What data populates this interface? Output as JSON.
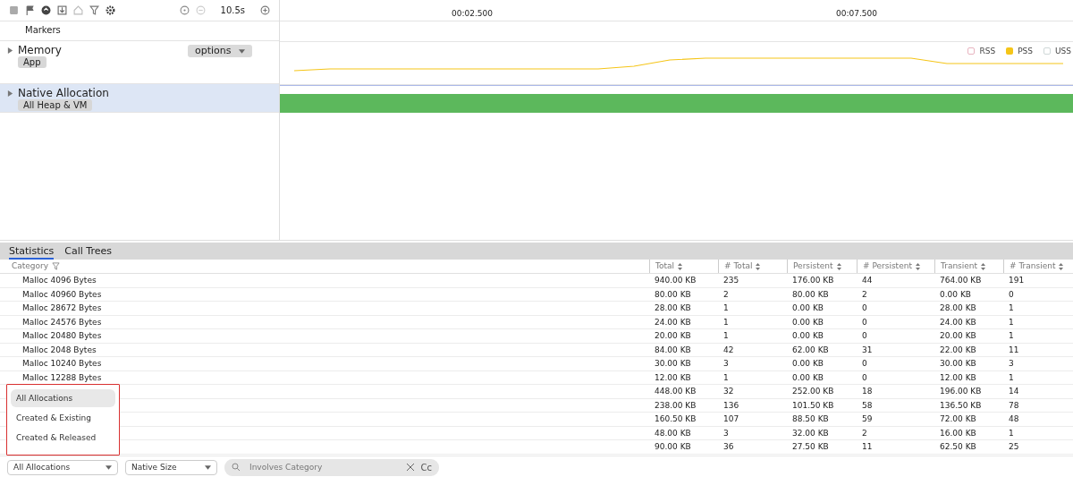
{
  "toolbar": {
    "duration": "10.5s"
  },
  "timeline": {
    "ticks": [
      "00:02.500",
      "00:07.500"
    ]
  },
  "tracks": [
    {
      "kind": "markers",
      "title": "Markers"
    },
    {
      "kind": "memory",
      "title": "Memory",
      "tag": "App",
      "options": "options",
      "expanded": false,
      "selected": false,
      "legend": [
        {
          "label": "RSS",
          "color": "#e8b4c0",
          "on": false
        },
        {
          "label": "PSS",
          "color": "#f5c518",
          "on": true
        },
        {
          "label": "USS",
          "color": "#cfd8d8",
          "on": false
        }
      ]
    },
    {
      "kind": "native",
      "title": "Native Allocation",
      "tag": "All Heap & VM",
      "expanded": false,
      "selected": true
    }
  ],
  "tabs": [
    {
      "label": "Statistics",
      "selected": true
    },
    {
      "label": "Call Trees",
      "selected": false
    }
  ],
  "table": {
    "columns": [
      "Category",
      "Total",
      "# Total",
      "Persistent",
      "# Persistent",
      "Transient",
      "# Transient"
    ],
    "rows": [
      {
        "category": "Malloc 4096 Bytes",
        "values": [
          "940.00 KB",
          "235",
          "176.00 KB",
          "44",
          "764.00 KB",
          "191"
        ]
      },
      {
        "category": "Malloc 40960 Bytes",
        "values": [
          "80.00 KB",
          "2",
          "80.00 KB",
          "2",
          "0.00 KB",
          "0"
        ]
      },
      {
        "category": "Malloc 28672 Bytes",
        "values": [
          "28.00 KB",
          "1",
          "0.00 KB",
          "0",
          "28.00 KB",
          "1"
        ]
      },
      {
        "category": "Malloc 24576 Bytes",
        "values": [
          "24.00 KB",
          "1",
          "0.00 KB",
          "0",
          "24.00 KB",
          "1"
        ]
      },
      {
        "category": "Malloc 20480 Bytes",
        "values": [
          "20.00 KB",
          "1",
          "0.00 KB",
          "0",
          "20.00 KB",
          "1"
        ]
      },
      {
        "category": "Malloc 2048 Bytes",
        "values": [
          "84.00 KB",
          "42",
          "62.00 KB",
          "31",
          "22.00 KB",
          "11"
        ]
      },
      {
        "category": "Malloc 10240 Bytes",
        "values": [
          "30.00 KB",
          "3",
          "0.00 KB",
          "0",
          "30.00 KB",
          "3"
        ]
      },
      {
        "category": "Malloc 12288 Bytes",
        "values": [
          "12.00 KB",
          "1",
          "0.00 KB",
          "0",
          "12.00 KB",
          "1"
        ]
      },
      {
        "values": [
          "448.00 KB",
          "32",
          "252.00 KB",
          "18",
          "196.00 KB",
          "14"
        ]
      },
      {
        "values": [
          "238.00 KB",
          "136",
          "101.50 KB",
          "58",
          "136.50 KB",
          "78"
        ]
      },
      {
        "values": [
          "160.50 KB",
          "107",
          "88.50 KB",
          "59",
          "72.00 KB",
          "48"
        ]
      },
      {
        "values": [
          "48.00 KB",
          "3",
          "32.00 KB",
          "2",
          "16.00 KB",
          "1"
        ]
      },
      {
        "values": [
          "90.00 KB",
          "36",
          "27.50 KB",
          "11",
          "62.50 KB",
          "25"
        ]
      }
    ]
  },
  "menu": {
    "items": [
      {
        "label": "All Allocations",
        "selected": true
      },
      {
        "label": "Created & Existing",
        "selected": false
      },
      {
        "label": "Created & Released",
        "selected": false
      }
    ]
  },
  "footer": {
    "mode": "All Allocations",
    "size": "Native Size",
    "search_placeholder": "Involves Category",
    "case_toggle": "Cc"
  }
}
